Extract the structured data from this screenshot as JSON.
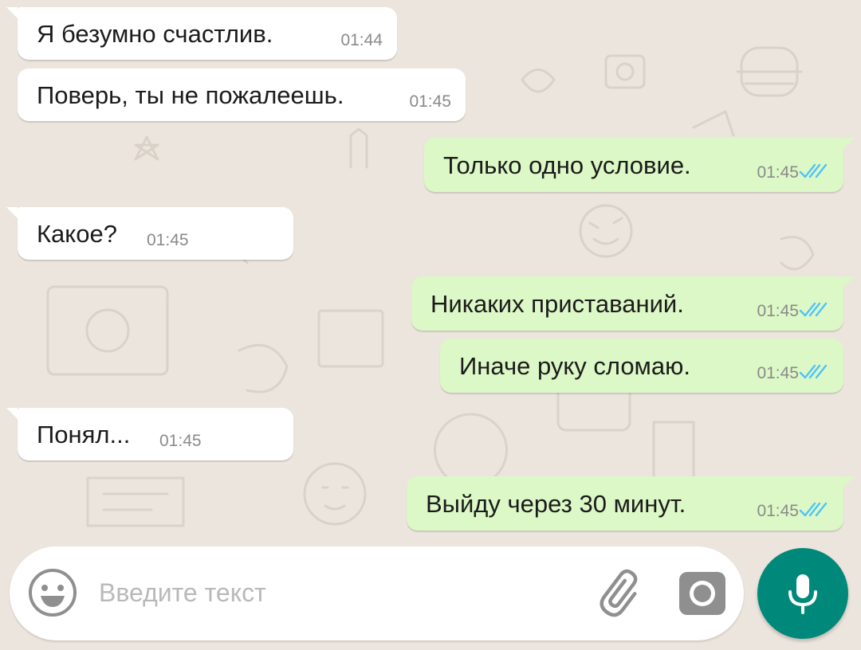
{
  "messages": [
    {
      "direction": "incoming",
      "text": "Я безумно счастлив.",
      "time": "01:44"
    },
    {
      "direction": "incoming",
      "text": "Поверь, ты не пожалеешь.",
      "time": "01:45"
    },
    {
      "direction": "outgoing",
      "text": "Только одно условие.",
      "time": "01:45",
      "status": "read"
    },
    {
      "direction": "incoming",
      "text": "Какое?",
      "time": "01:45"
    },
    {
      "direction": "outgoing",
      "text": "Никаких приставаний.",
      "time": "01:45",
      "status": "read"
    },
    {
      "direction": "outgoing",
      "text": "Иначе руку сломаю.",
      "time": "01:45",
      "status": "read"
    },
    {
      "direction": "incoming",
      "text": "Понял...",
      "time": "01:45"
    },
    {
      "direction": "outgoing",
      "text": "Выйду через 30 минут.",
      "time": "01:45",
      "status": "read"
    }
  ],
  "composer": {
    "placeholder": "Введите текст",
    "emoji_icon": "emoji-icon",
    "attach_icon": "paperclip-icon",
    "camera_icon": "camera-icon",
    "mic_icon": "microphone-icon"
  },
  "colors": {
    "background": "#ece5dd",
    "incoming_bubble": "#ffffff",
    "outgoing_bubble": "#dcf8c6",
    "read_ticks": "#4fc3f7",
    "accent": "#00897b"
  }
}
